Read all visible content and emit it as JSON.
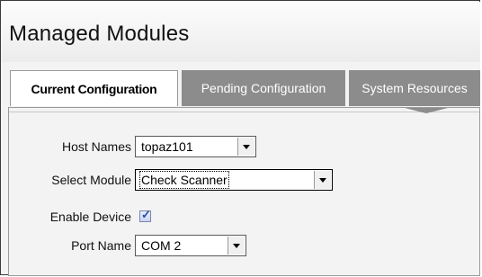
{
  "window": {
    "title": "Managed Modules"
  },
  "tabs": [
    {
      "label": "Current Configuration",
      "active": true
    },
    {
      "label": "Pending Configuration",
      "active": false
    },
    {
      "label": "System Resources",
      "active": false
    }
  ],
  "form": {
    "host_names": {
      "label": "Host Names",
      "value": "topaz101"
    },
    "select_module": {
      "label": "Select Module",
      "value": "Check Scanner"
    },
    "enable_device": {
      "label": "Enable Device",
      "checked": true
    },
    "port_name": {
      "label": "Port Name",
      "value": "COM 2"
    }
  },
  "colors": {
    "inactive_tab": "#8c8c8c",
    "active_tab": "#ffffff",
    "panel": "#f3f3f3",
    "checkbox_accent": "#2a4aa8"
  },
  "icons": {
    "dropdown": "chevron-down-icon",
    "checkbox": "check-icon"
  }
}
